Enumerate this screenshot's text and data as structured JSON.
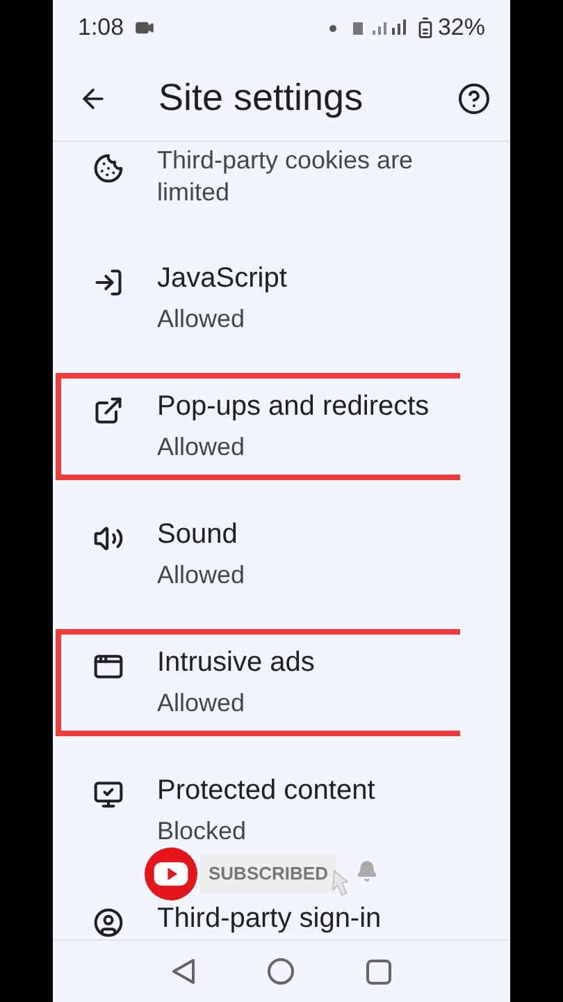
{
  "status_bar": {
    "time": "1:08",
    "battery": "32%"
  },
  "app_bar": {
    "title": "Site settings"
  },
  "settings": [
    {
      "subtitle": "Third-party cookies are limited",
      "highlighted": false
    },
    {
      "title": "JavaScript",
      "subtitle": "Allowed",
      "highlighted": false
    },
    {
      "title": "Pop-ups and redirects",
      "subtitle": "Allowed",
      "highlighted": true
    },
    {
      "title": "Sound",
      "subtitle": "Allowed",
      "highlighted": false
    },
    {
      "title": "Intrusive ads",
      "subtitle": "Allowed",
      "highlighted": true
    },
    {
      "title": "Protected content",
      "subtitle": "Blocked",
      "highlighted": false
    },
    {
      "title": "Third-party sign-in",
      "highlighted": false
    }
  ],
  "subscribe_overlay": {
    "label": "SUBSCRIBED"
  }
}
